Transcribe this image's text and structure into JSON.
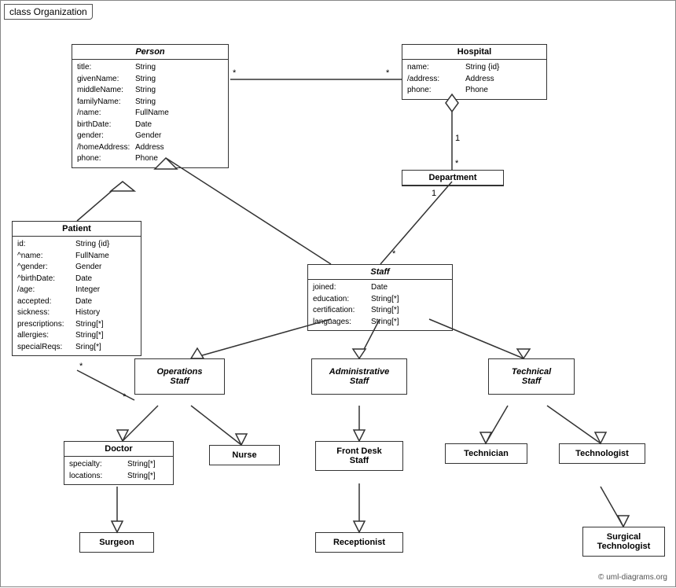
{
  "title": "class Organization",
  "copyright": "© uml-diagrams.org",
  "boxes": {
    "person": {
      "title": "Person",
      "attrs": [
        [
          "title:",
          "String"
        ],
        [
          "givenName:",
          "String"
        ],
        [
          "middleName:",
          "String"
        ],
        [
          "familyName:",
          "String"
        ],
        [
          "/name:",
          "FullName"
        ],
        [
          "birthDate:",
          "Date"
        ],
        [
          "gender:",
          "Gender"
        ],
        [
          "/homeAddress:",
          "Address"
        ],
        [
          "phone:",
          "Phone"
        ]
      ]
    },
    "hospital": {
      "title": "Hospital",
      "attrs": [
        [
          "name:",
          "String {id}"
        ],
        [
          "/address:",
          "Address"
        ],
        [
          "phone:",
          "Phone"
        ]
      ]
    },
    "patient": {
      "title": "Patient",
      "attrs": [
        [
          "id:",
          "String {id}"
        ],
        [
          "^name:",
          "FullName"
        ],
        [
          "^gender:",
          "Gender"
        ],
        [
          "^birthDate:",
          "Date"
        ],
        [
          "/age:",
          "Integer"
        ],
        [
          "accepted:",
          "Date"
        ],
        [
          "sickness:",
          "History"
        ],
        [
          "prescriptions:",
          "String[*]"
        ],
        [
          "allergies:",
          "String[*]"
        ],
        [
          "specialReqs:",
          "Sring[*]"
        ]
      ]
    },
    "department": {
      "title": "Department"
    },
    "staff": {
      "title": "Staff",
      "attrs": [
        [
          "joined:",
          "Date"
        ],
        [
          "education:",
          "String[*]"
        ],
        [
          "certification:",
          "String[*]"
        ],
        [
          "languages:",
          "String[*]"
        ]
      ]
    },
    "operations_staff": {
      "title": "Operations\nStaff"
    },
    "administrative_staff": {
      "title": "Administrative\nStaff"
    },
    "technical_staff": {
      "title": "Technical\nStaff"
    },
    "doctor": {
      "title": "Doctor",
      "attrs": [
        [
          "specialty:",
          "String[*]"
        ],
        [
          "locations:",
          "String[*]"
        ]
      ]
    },
    "nurse": {
      "title": "Nurse"
    },
    "front_desk_staff": {
      "title": "Front Desk\nStaff"
    },
    "technician": {
      "title": "Technician"
    },
    "technologist": {
      "title": "Technologist"
    },
    "surgeon": {
      "title": "Surgeon"
    },
    "receptionist": {
      "title": "Receptionist"
    },
    "surgical_technologist": {
      "title": "Surgical\nTechnologist"
    }
  }
}
